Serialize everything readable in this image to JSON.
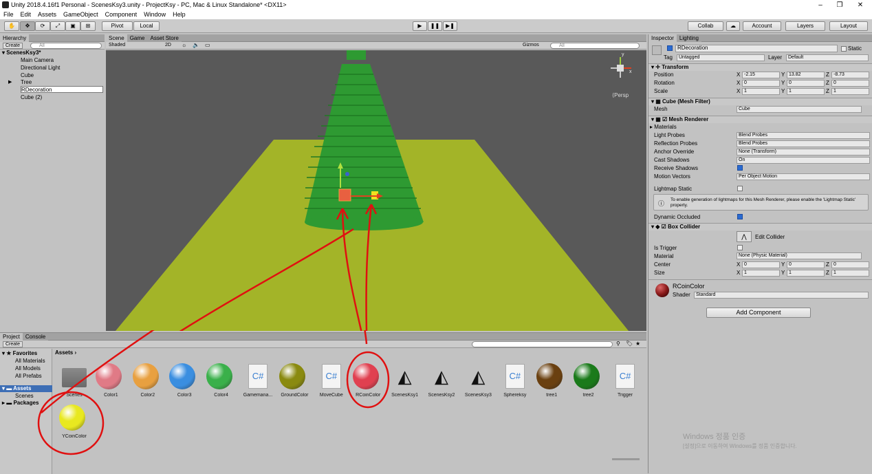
{
  "window": {
    "title": "Unity 2018.4.16f1 Personal - ScenesKsy3.unity - ProjectKsy - PC, Mac & Linux Standalone* <DX11>"
  },
  "menu": [
    "File",
    "Edit",
    "Assets",
    "GameObject",
    "Component",
    "Window",
    "Help"
  ],
  "toolbar": {
    "pivot": "Pivot",
    "local": "Local",
    "collab": "Collab",
    "account": "Account",
    "layers": "Layers",
    "layout": "Layout"
  },
  "hierarchy": {
    "tab": "Hierarchy",
    "create": "Create",
    "search": "All",
    "scene": "ScenesKsy3*",
    "items": [
      "Main Camera",
      "Directional Light",
      "Cube",
      "Tree",
      "RDecoration",
      "Cube (2)"
    ]
  },
  "scene": {
    "tabs": [
      "Scene",
      "Game",
      "Asset Store"
    ],
    "shading": "Shaded",
    "mode2d": "2D",
    "gizmos": "Gizmos",
    "search": "All",
    "persp": "Persp",
    "gizmo_axes": [
      "y",
      "x"
    ]
  },
  "inspector": {
    "tabs": [
      "Inspector",
      "Lighting"
    ],
    "name": "RDecoration",
    "static": "Static",
    "tag_label": "Tag",
    "tag": "Untagged",
    "layer_label": "Layer",
    "layer": "Default",
    "transform": {
      "title": "Transform",
      "position_label": "Position",
      "rotation_label": "Rotation",
      "scale_label": "Scale",
      "axes": [
        "X",
        "Y",
        "Z"
      ],
      "position": [
        "-2.15",
        "13.82",
        "-8.73"
      ],
      "rotation": [
        "0",
        "0",
        "0"
      ],
      "scale": [
        "1",
        "1",
        "1"
      ]
    },
    "mesh_filter": {
      "title": "Cube (Mesh Filter)",
      "mesh_label": "Mesh",
      "mesh": "Cube"
    },
    "mesh_renderer": {
      "title": "Mesh Renderer",
      "materials": "Materials",
      "rows": [
        {
          "label": "Light Probes",
          "value": "Blend Probes"
        },
        {
          "label": "Reflection Probes",
          "value": "Blend Probes"
        },
        {
          "label": "Anchor Override",
          "value": "None (Transform)"
        },
        {
          "label": "Cast Shadows",
          "value": "On"
        },
        {
          "label": "Receive Shadows",
          "value": ""
        },
        {
          "label": "Motion Vectors",
          "value": "Per Object Motion"
        }
      ],
      "lightmap_static": "Lightmap Static",
      "info": "To enable generation of lightmaps for this Mesh Renderer, please enable the 'Lightmap Static' property.",
      "dynamic_occluded": "Dynamic Occluded"
    },
    "box_collider": {
      "title": "Box Collider",
      "edit": "Edit Collider",
      "is_trigger": "Is Trigger",
      "material_label": "Material",
      "material": "None (Physic Material)",
      "center_label": "Center",
      "center": [
        "0",
        "0",
        "0"
      ],
      "size_label": "Size",
      "size": [
        "1",
        "1",
        "1"
      ]
    },
    "material": {
      "name": "RCoinColor",
      "shader_label": "Shader",
      "shader": "Standard",
      "color": "#8a1a1a"
    },
    "add_component": "Add Component"
  },
  "project": {
    "tabs": [
      "Project",
      "Console"
    ],
    "create": "Create",
    "favorites": "Favorites",
    "fav_items": [
      "All Materials",
      "All Models",
      "All Prefabs"
    ],
    "assets_root": "Assets",
    "asset_tree": [
      "Scenes"
    ],
    "packages": "Packages",
    "breadcrumb": "Assets",
    "assets": [
      {
        "name": "Scenes",
        "kind": "folder"
      },
      {
        "name": "Color1",
        "kind": "material",
        "color": "#e07a86"
      },
      {
        "name": "Color2",
        "kind": "material",
        "color": "#e8a040"
      },
      {
        "name": "Color3",
        "kind": "material",
        "color": "#3a8ee0"
      },
      {
        "name": "Color4",
        "kind": "material",
        "color": "#3ab04a"
      },
      {
        "name": "Gamemana...",
        "kind": "script"
      },
      {
        "name": "GroundColor",
        "kind": "material",
        "color": "#8a8a10"
      },
      {
        "name": "MoveCube",
        "kind": "script"
      },
      {
        "name": "RCoinColor",
        "kind": "material",
        "color": "#e04050"
      },
      {
        "name": "ScenesKsy1",
        "kind": "unity"
      },
      {
        "name": "ScenesKsy2",
        "kind": "unity"
      },
      {
        "name": "ScenesKsy3",
        "kind": "unity"
      },
      {
        "name": "Sphereksy",
        "kind": "script"
      },
      {
        "name": "tree1",
        "kind": "material",
        "color": "#6a4010"
      },
      {
        "name": "tree2",
        "kind": "material",
        "color": "#1a7a1a"
      },
      {
        "name": "Trigger",
        "kind": "script"
      },
      {
        "name": "YCoinColor",
        "kind": "material",
        "color": "#e8e820"
      }
    ]
  },
  "watermark": {
    "line1": "Windows 정품 인증",
    "line2": "[설정]으로 이동하여 Windows를 정품 인증합니다."
  }
}
